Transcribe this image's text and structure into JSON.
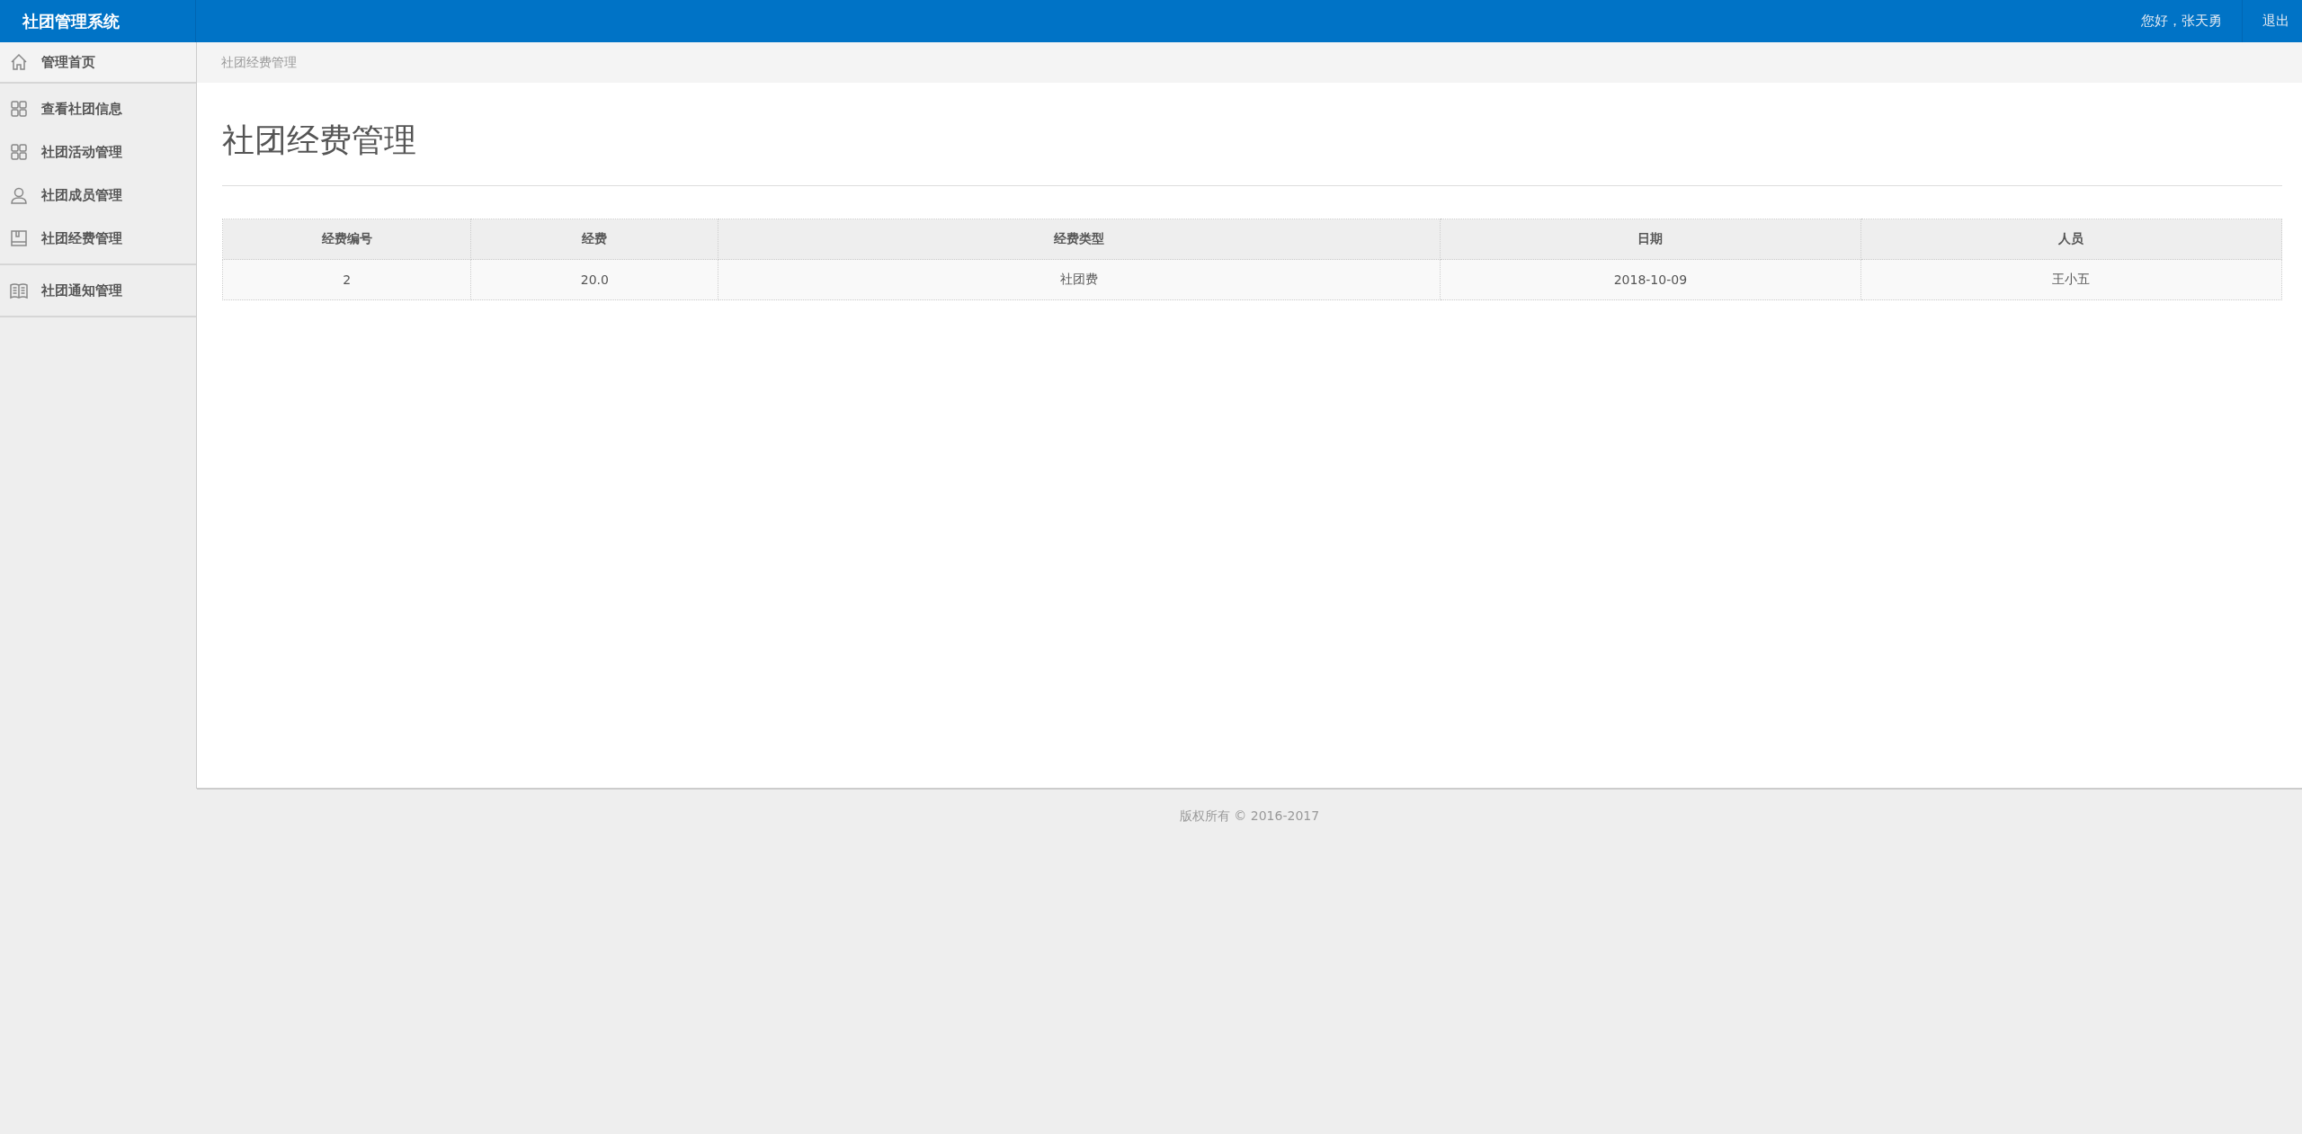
{
  "header": {
    "title": "社团管理系统",
    "greeting": "您好，张天勇",
    "logout": "退出"
  },
  "sidebar": {
    "groups": [
      {
        "items": [
          {
            "label": "管理首页"
          }
        ]
      },
      {
        "items": [
          {
            "label": "查看社团信息"
          },
          {
            "label": "社团活动管理"
          },
          {
            "label": "社团成员管理"
          },
          {
            "label": "社团经费管理"
          }
        ]
      },
      {
        "items": [
          {
            "label": "社团通知管理"
          }
        ]
      }
    ]
  },
  "breadcrumb": "社团经费管理",
  "page_title": "社团经费管理",
  "table": {
    "columns": [
      "经费编号",
      "经费",
      "经费类型",
      "日期",
      "人员"
    ],
    "rows": [
      [
        "2",
        "20.0",
        "社团费",
        "2018-10-09",
        "王小五"
      ]
    ]
  },
  "footer": "版权所有 © 2016-2017"
}
